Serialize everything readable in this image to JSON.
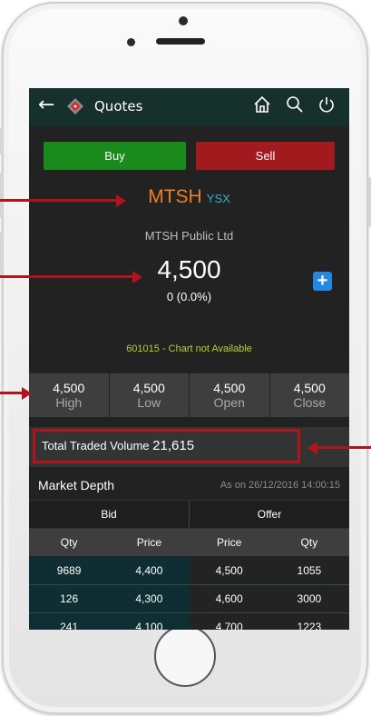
{
  "header": {
    "title": "Quotes"
  },
  "actions": {
    "buy_label": "Buy",
    "sell_label": "Sell"
  },
  "quote": {
    "symbol": "MTSH",
    "exchange": "YSX",
    "company": "MTSH Public Ltd",
    "price": "4,500",
    "change": "0 (0.0%)",
    "add_label": "+",
    "chart_message": "601015 - Chart not Available"
  },
  "stats": [
    {
      "value": "4,500",
      "label": "High"
    },
    {
      "value": "4,500",
      "label": "Low"
    },
    {
      "value": "4,500",
      "label": "Open"
    },
    {
      "value": "4,500",
      "label": "Close"
    }
  ],
  "volume": {
    "label": "Total Traded Volume",
    "value": "21,615"
  },
  "market_depth": {
    "title": "Market Depth",
    "as_of": "As on 26/12/2016 14:00:15",
    "bid_label": "Bid",
    "offer_label": "Offer",
    "columns": [
      "Qty",
      "Price",
      "Price",
      "Qty"
    ],
    "rows": [
      [
        "9689",
        "4,400",
        "4,500",
        "1055"
      ],
      [
        "126",
        "4,300",
        "4,600",
        "3000"
      ],
      [
        "241",
        "4,100",
        "4,700",
        "1223"
      ]
    ]
  },
  "colors": {
    "buy": "#1b8a1c",
    "sell": "#a31a1e",
    "symbol": "#f07f24",
    "exchange": "#2fb3c9",
    "annotation": "#b1141b"
  }
}
